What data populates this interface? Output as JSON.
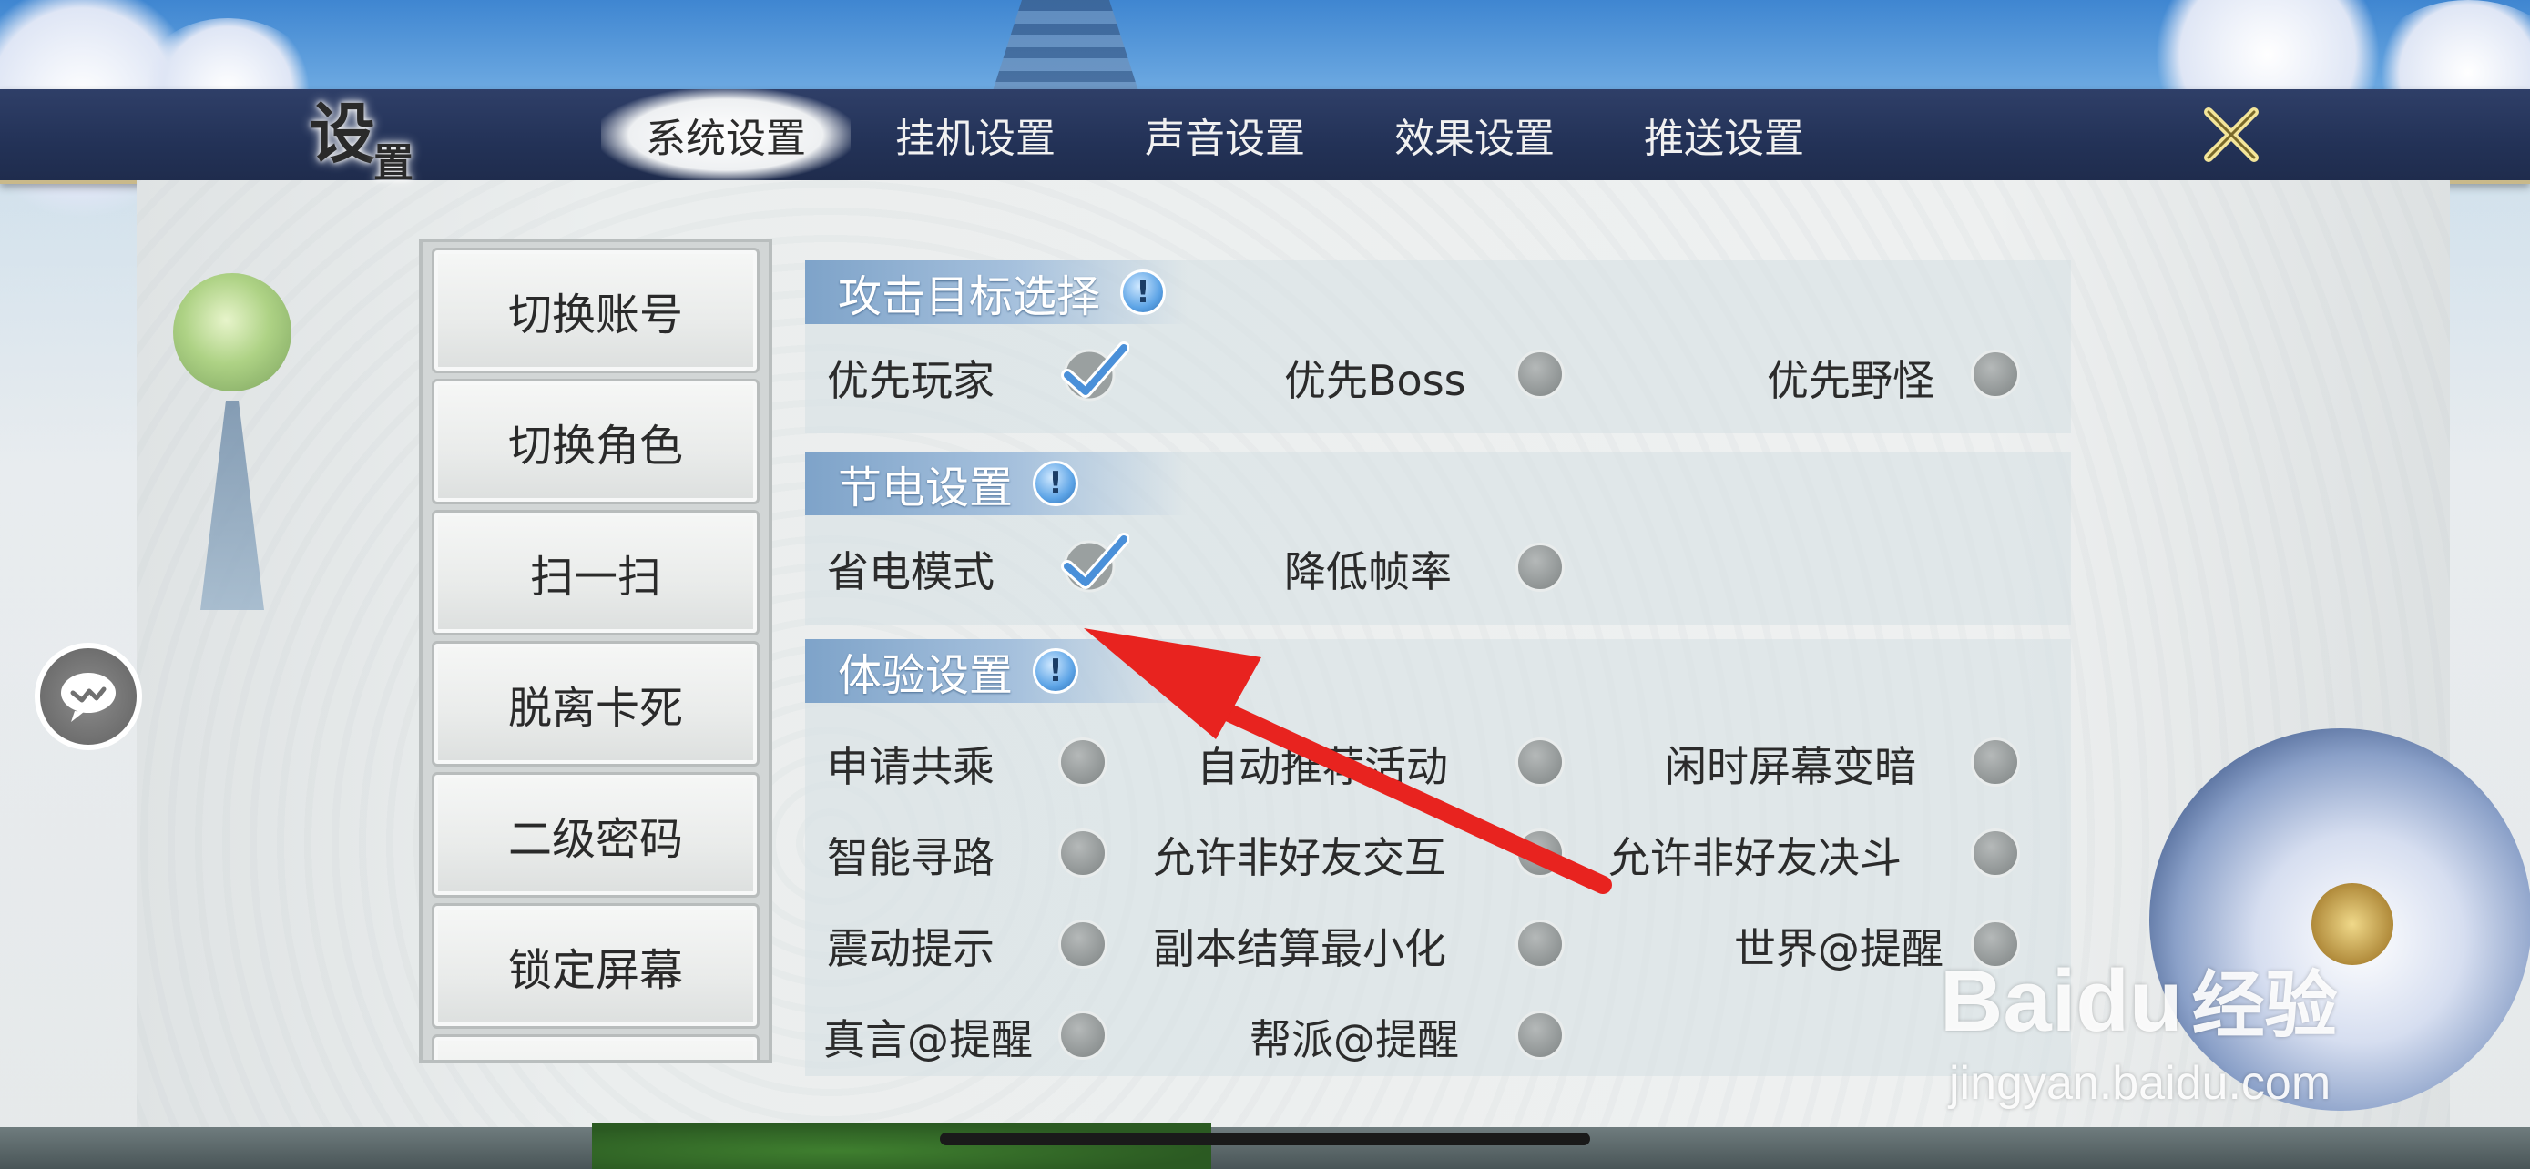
{
  "window": {
    "title_main": "设",
    "title_small": "置"
  },
  "tabs": [
    {
      "label": "系统设置",
      "active": true
    },
    {
      "label": "挂机设置",
      "active": false
    },
    {
      "label": "声音设置",
      "active": false
    },
    {
      "label": "效果设置",
      "active": false
    },
    {
      "label": "推送设置",
      "active": false
    }
  ],
  "close_icon": "close-x-icon",
  "left_menu": [
    {
      "label": "切换账号"
    },
    {
      "label": "切换角色"
    },
    {
      "label": "扫一扫"
    },
    {
      "label": "脱离卡死"
    },
    {
      "label": "二级密码"
    },
    {
      "label": "锁定屏幕"
    }
  ],
  "sections": {
    "attack_target": {
      "title": "攻击目标选择",
      "options": [
        {
          "label": "优先玩家",
          "checked": true
        },
        {
          "label": "优先Boss",
          "checked": false
        },
        {
          "label": "优先野怪",
          "checked": false
        }
      ]
    },
    "power_saving": {
      "title": "节电设置",
      "options": [
        {
          "label": "省电模式",
          "checked": true
        },
        {
          "label": "降低帧率",
          "checked": false
        }
      ]
    },
    "experience": {
      "title": "体验设置",
      "options": [
        {
          "label": "申请共乘",
          "checked": false
        },
        {
          "label": "自动推荐活动",
          "checked": false
        },
        {
          "label": "闲时屏幕变暗",
          "checked": false
        },
        {
          "label": "智能寻路",
          "checked": false
        },
        {
          "label": "允许非好友交互",
          "checked": false
        },
        {
          "label": "允许非好友决斗",
          "checked": false
        },
        {
          "label": "震动提示",
          "checked": false
        },
        {
          "label": "副本结算最小化",
          "checked": false
        },
        {
          "label": "世界@提醒",
          "checked": false
        },
        {
          "label": "真言@提醒",
          "checked": false
        },
        {
          "label": "帮派@提醒",
          "checked": false
        }
      ]
    }
  },
  "info_icon_glyph": "!",
  "watermark": {
    "logo_latin": "Bai",
    "logo_du": "du",
    "logo_cn": "经验",
    "url": "jingyan.baidu.com"
  },
  "colors": {
    "header_bg": "#233257",
    "section_header": "#7ea3c9",
    "checkmark": "#4a90d9",
    "radio_off": "#8f9494",
    "arrow": "#e8231f"
  }
}
